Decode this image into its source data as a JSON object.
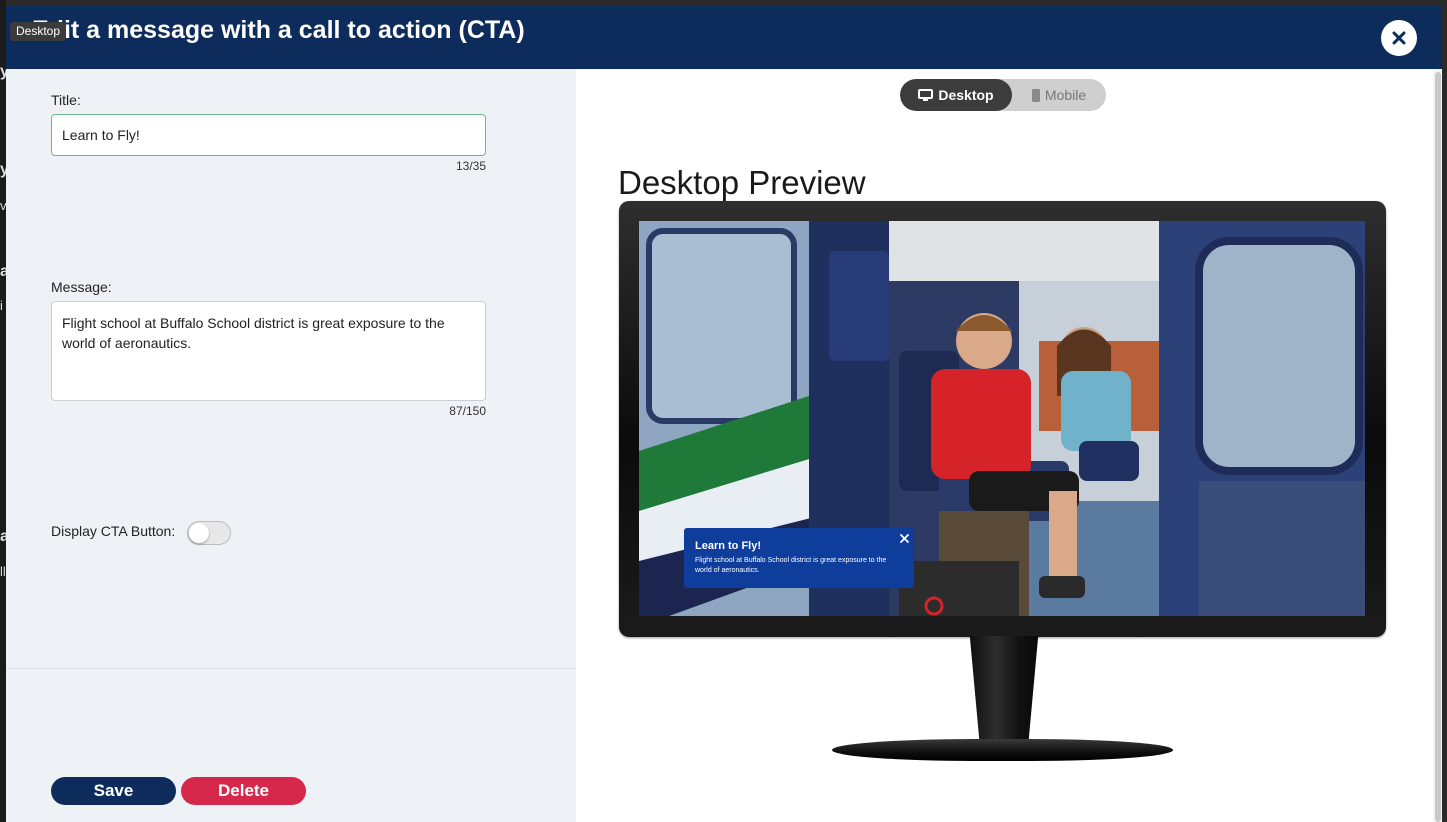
{
  "background": {
    "letters": [
      "y",
      "y",
      "v",
      "a",
      "i",
      "a",
      "ll"
    ]
  },
  "modal": {
    "title": "Edit a message with a call to action (CTA)",
    "tooltip": "Desktop",
    "close_icon": "close-icon"
  },
  "form": {
    "title_label": "Title:",
    "title_value": "Learn to Fly!",
    "title_counter": "13/35",
    "message_label": "Message:",
    "message_value": "Flight school at Buffalo School district is great exposure to the world of aeronautics.",
    "message_counter": "87/150",
    "cta_label": "Display CTA Button:",
    "cta_enabled": false
  },
  "actions": {
    "save_label": "Save",
    "delete_label": "Delete"
  },
  "preview": {
    "toggle": {
      "desktop_label": "Desktop",
      "mobile_label": "Mobile",
      "selected": "Desktop",
      "desktop_icon": "monitor-icon",
      "mobile_icon": "phone-icon"
    },
    "heading": "Desktop Preview",
    "cta_popup": {
      "title": "Learn to Fly!",
      "message": "Flight school at Buffalo School district is great exposure to the world of aeronautics."
    }
  },
  "colors": {
    "header": "#0d2c5c",
    "save": "#0d2c5c",
    "delete": "#d6284a",
    "cta_popup": "#0e3d9c",
    "title_input_border": "#6cb88a"
  }
}
